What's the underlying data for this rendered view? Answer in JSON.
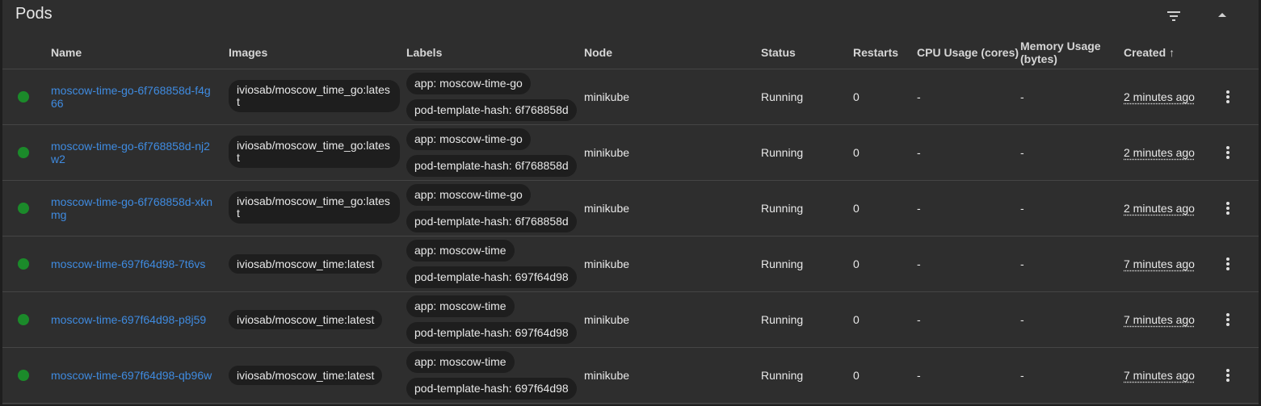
{
  "panel": {
    "title": "Pods",
    "filter_icon": "filter-list-icon",
    "collapse_icon": "arrow-up-icon"
  },
  "columns": {
    "name": "Name",
    "images": "Images",
    "labels": "Labels",
    "node": "Node",
    "status": "Status",
    "restarts": "Restarts",
    "cpu": "CPU Usage (cores)",
    "memory_line1": "Memory Usage",
    "memory_line2": "(bytes)",
    "created": "Created",
    "created_sort": "↑"
  },
  "colors": {
    "running": "#1b8a2a",
    "link": "#3f8be0",
    "background": "#2e2e2e"
  },
  "rows": [
    {
      "name": "moscow-time-go-6f768858d-f4g66",
      "image": "iviosab/moscow_time_go:latest",
      "label1": "app: moscow-time-go",
      "label2": "pod-template-hash: 6f768858d",
      "node": "minikube",
      "status": "Running",
      "restarts": "0",
      "cpu": "-",
      "memory": "-",
      "created": "2 minutes ago"
    },
    {
      "name": "moscow-time-go-6f768858d-nj2w2",
      "image": "iviosab/moscow_time_go:latest",
      "label1": "app: moscow-time-go",
      "label2": "pod-template-hash: 6f768858d",
      "node": "minikube",
      "status": "Running",
      "restarts": "0",
      "cpu": "-",
      "memory": "-",
      "created": "2 minutes ago"
    },
    {
      "name": "moscow-time-go-6f768858d-xknmg",
      "image": "iviosab/moscow_time_go:latest",
      "label1": "app: moscow-time-go",
      "label2": "pod-template-hash: 6f768858d",
      "node": "minikube",
      "status": "Running",
      "restarts": "0",
      "cpu": "-",
      "memory": "-",
      "created": "2 minutes ago"
    },
    {
      "name": "moscow-time-697f64d98-7t6vs",
      "image": "iviosab/moscow_time:latest",
      "label1": "app: moscow-time",
      "label2": "pod-template-hash: 697f64d98",
      "node": "minikube",
      "status": "Running",
      "restarts": "0",
      "cpu": "-",
      "memory": "-",
      "created": "7 minutes ago"
    },
    {
      "name": "moscow-time-697f64d98-p8j59",
      "image": "iviosab/moscow_time:latest",
      "label1": "app: moscow-time",
      "label2": "pod-template-hash: 697f64d98",
      "node": "minikube",
      "status": "Running",
      "restarts": "0",
      "cpu": "-",
      "memory": "-",
      "created": "7 minutes ago"
    },
    {
      "name": "moscow-time-697f64d98-qb96w",
      "image": "iviosab/moscow_time:latest",
      "label1": "app: moscow-time",
      "label2": "pod-template-hash: 697f64d98",
      "node": "minikube",
      "status": "Running",
      "restarts": "0",
      "cpu": "-",
      "memory": "-",
      "created": "7 minutes ago"
    }
  ]
}
